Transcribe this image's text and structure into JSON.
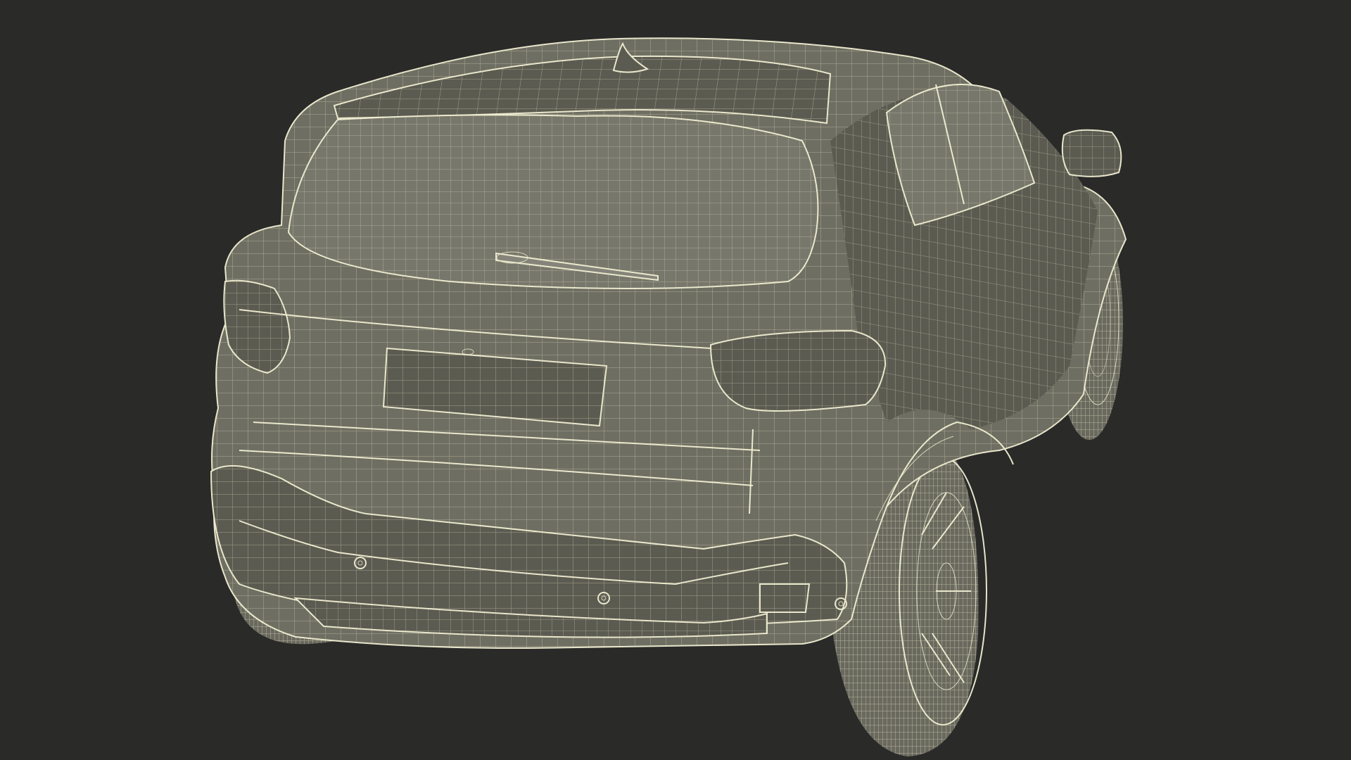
{
  "scene": {
    "subject": "",
    "colors": {
      "background": "#2a2a29",
      "body": "#6f6e62",
      "wire": "#e8e6c8"
    }
  }
}
